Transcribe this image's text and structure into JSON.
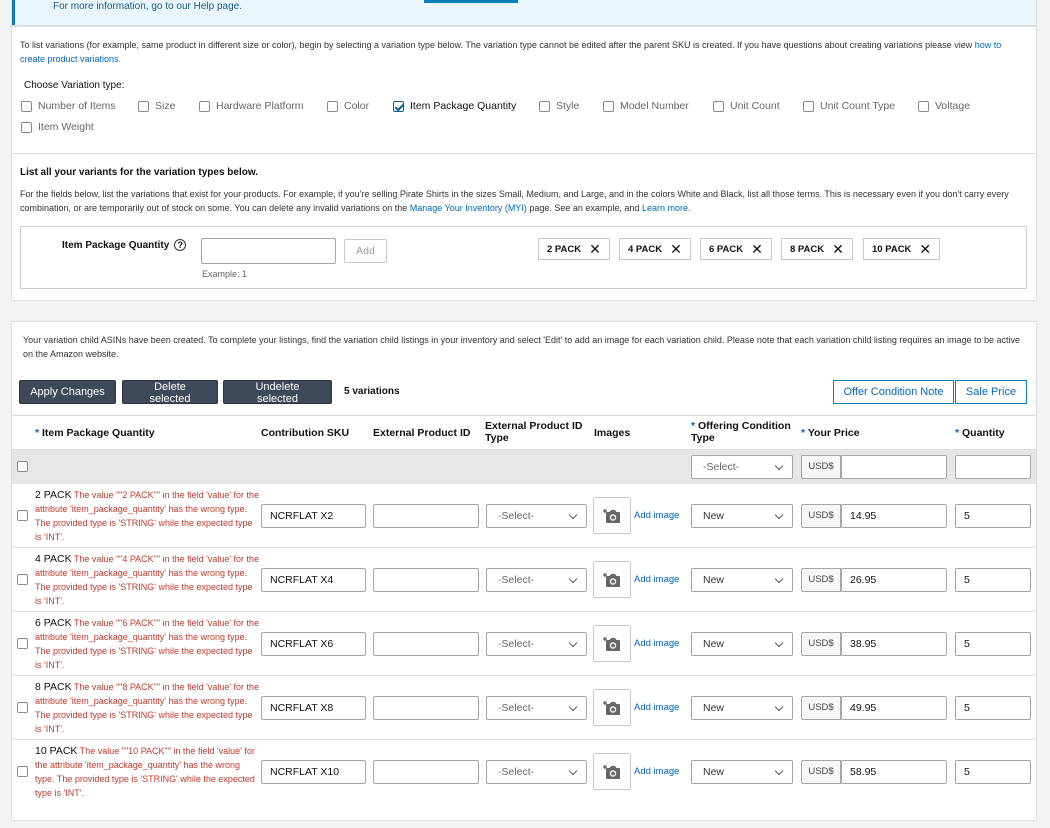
{
  "top": {
    "info_text": "For more information, go to our Help page."
  },
  "variation": {
    "intro_text": "To list variations (for example, same product in different size or color), begin by selecting a variation type below. The variation type cannot be edited after the parent SKU is created. If you have questions about creating variations please view",
    "intro_link": "how to create product variations.",
    "choose_title": "Choose Variation type:",
    "types": [
      {
        "label": "Number of Items",
        "checked": false
      },
      {
        "label": "Size",
        "checked": false
      },
      {
        "label": "Hardware Platform",
        "checked": false
      },
      {
        "label": "Color",
        "checked": false
      },
      {
        "label": "Item Package Quantity",
        "checked": true
      },
      {
        "label": "Style",
        "checked": false
      },
      {
        "label": "Model Number",
        "checked": false
      },
      {
        "label": "Unit Count",
        "checked": false
      },
      {
        "label": "Unit Count Type",
        "checked": false
      },
      {
        "label": "Voltage",
        "checked": false
      },
      {
        "label": "Item Weight",
        "checked": false
      }
    ],
    "list_title": "List all your variants for the variation types below.",
    "list_desc_1": "For the fields below, list the variations that exist for your products. For example, if you're selling Pirate Shirts in the sizes Small, Medium, and Large, and in the colors White and Black, list all those terms. This is necessary even if you don't carry every combination, or are temporarily out of stock on some. You can delete any invalid variations on the",
    "list_desc_link1": "Manage Your Inventory (MYI)",
    "list_desc_2": "page. See an example, and",
    "list_desc_link2": "Learn more.",
    "field_label": "Item Package Quantity",
    "field_value": "",
    "add_label": "Add",
    "example": "Example: 1",
    "chips": [
      "2 PACK",
      "4 PACK",
      "6 PACK",
      "8 PACK",
      "10 PACK"
    ]
  },
  "children": {
    "created_msg": "Your variation child ASINs have been created. To complete your listings, find the variation child listings in your inventory and select 'Edit' to add an image for each variation child. Please note that each variation child listing requires an image to be active on the Amazon website.",
    "apply_label": "Apply Changes",
    "delete_label": "Delete selected",
    "undelete_label": "Undelete selected",
    "count_text": "5 variations",
    "offer_note_label": "Offer Condition Note",
    "sale_price_label": "Sale Price",
    "headers": {
      "ipq": "Item Package Quantity",
      "sku": "Contribution SKU",
      "ext_id": "External Product ID",
      "ext_type": "External Product ID Type",
      "images": "Images",
      "condition": "Offering Condition Type",
      "price": "Your Price",
      "qty": "Quantity"
    },
    "bulk": {
      "condition": "-Select-",
      "currency": "USD$",
      "price": "",
      "qty": ""
    },
    "rows": [
      {
        "pack": "2 PACK",
        "error": "The value \"\"2 PACK\"\" in the field 'value' for the attribute 'item_package_quantity' has the wrong type. The provided type is 'STRING' while the expected type is 'INT'.",
        "sku": "NCRFLAT X2",
        "ext_id": "",
        "ext_type": "-Select-",
        "add_image": "Add image",
        "condition": "New",
        "currency": "USD$",
        "price": "14.95",
        "qty": "5"
      },
      {
        "pack": "4 PACK",
        "error": "The value \"\"4 PACK\"\" in the field 'value' for the attribute 'item_package_quantity' has the wrong type. The provided type is 'STRING' while the expected type is 'INT'.",
        "sku": "NCRFLAT X4",
        "ext_id": "",
        "ext_type": "-Select-",
        "add_image": "Add image",
        "condition": "New",
        "currency": "USD$",
        "price": "26.95",
        "qty": "5"
      },
      {
        "pack": "6 PACK",
        "error": "The value \"\"6 PACK\"\" in the field 'value' for the attribute 'item_package_quantity' has the wrong type. The provided type is 'STRING' while the expected type is 'INT'.",
        "sku": "NCRFLAT X6",
        "ext_id": "",
        "ext_type": "-Select-",
        "add_image": "Add image",
        "condition": "New",
        "currency": "USD$",
        "price": "38.95",
        "qty": "5"
      },
      {
        "pack": "8 PACK",
        "error": "The value \"\"8 PACK\"\" in the field 'value' for the attribute 'item_package_quantity' has the wrong type. The provided type is 'STRING' while the expected type is 'INT'.",
        "sku": "NCRFLAT X8",
        "ext_id": "",
        "ext_type": "-Select-",
        "add_image": "Add image",
        "condition": "New",
        "currency": "USD$",
        "price": "49.95",
        "qty": "5"
      },
      {
        "pack": "10 PACK",
        "error": "The value \"\"10 PACK\"\" in the field 'value' for the attribute 'item_package_quantity' has the wrong type. The provided type is 'STRING' while the expected type is 'INT'.",
        "sku": "NCRFLAT X10",
        "ext_id": "",
        "ext_type": "-Select-",
        "add_image": "Add image",
        "condition": "New",
        "currency": "USD$",
        "price": "58.95",
        "qty": "5"
      }
    ]
  },
  "colors": {
    "accent": "#0066c0",
    "error": "#c0392b",
    "dark_button": "#3e4958"
  }
}
